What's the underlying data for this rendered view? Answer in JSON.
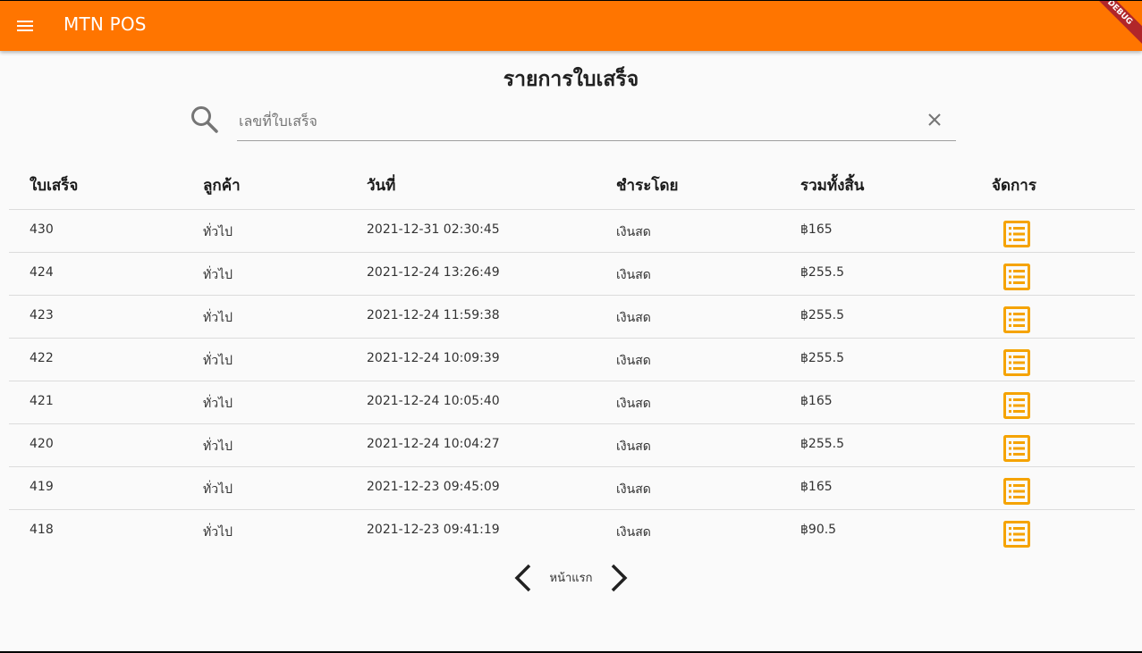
{
  "appbar": {
    "title": "MTN POS",
    "debug_banner": "DEBUG",
    "color": "#ff7500"
  },
  "page": {
    "title": "รายการใบเสร็จ"
  },
  "search": {
    "placeholder": "เลขที่ใบเสร็จ",
    "value": "",
    "icon": "search-icon",
    "clear_icon": "close-icon"
  },
  "table": {
    "headers": [
      "ใบเสร็จ",
      "ลูกค้า",
      "วันที่",
      "ชำระโดย",
      "รวมทั้งสิ้น",
      "จัดการ"
    ],
    "rows": [
      {
        "id": "430",
        "customer": "ทั่วไป",
        "date": "2021-12-31 02:30:45",
        "payment": "เงินสด",
        "total": "฿165"
      },
      {
        "id": "424",
        "customer": "ทั่วไป",
        "date": "2021-12-24 13:26:49",
        "payment": "เงินสด",
        "total": "฿255.5"
      },
      {
        "id": "423",
        "customer": "ทั่วไป",
        "date": "2021-12-24 11:59:38",
        "payment": "เงินสด",
        "total": "฿255.5"
      },
      {
        "id": "422",
        "customer": "ทั่วไป",
        "date": "2021-12-24 10:09:39",
        "payment": "เงินสด",
        "total": "฿255.5"
      },
      {
        "id": "421",
        "customer": "ทั่วไป",
        "date": "2021-12-24 10:05:40",
        "payment": "เงินสด",
        "total": "฿165"
      },
      {
        "id": "420",
        "customer": "ทั่วไป",
        "date": "2021-12-24 10:04:27",
        "payment": "เงินสด",
        "total": "฿255.5"
      },
      {
        "id": "419",
        "customer": "ทั่วไป",
        "date": "2021-12-23 09:45:09",
        "payment": "เงินสด",
        "total": "฿165"
      },
      {
        "id": "418",
        "customer": "ทั่วไป",
        "date": "2021-12-23 09:41:19",
        "payment": "เงินสด",
        "total": "฿90.5"
      }
    ],
    "action_icon": "list-alt-icon",
    "action_color": "#f5a300"
  },
  "pagination": {
    "label": "หน้าแรก",
    "prev_icon": "chevron-left-icon",
    "next_icon": "chevron-right-icon"
  }
}
